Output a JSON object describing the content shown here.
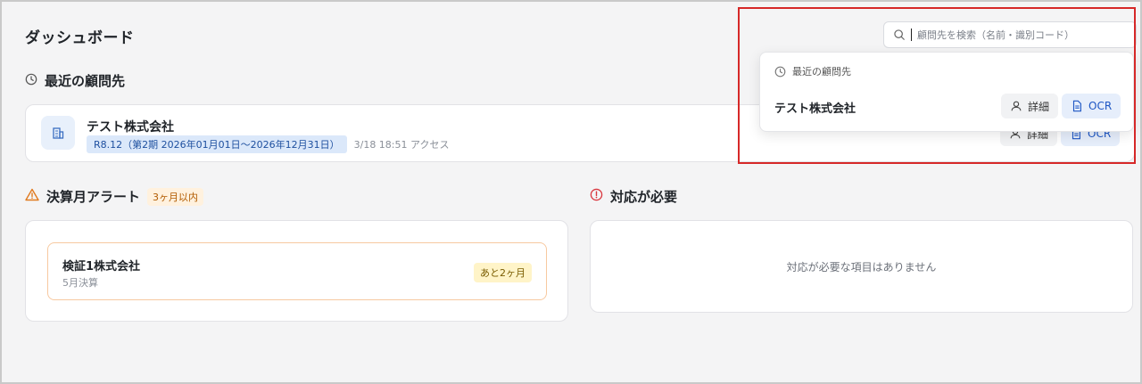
{
  "page": {
    "title": "ダッシュボード"
  },
  "search": {
    "placeholder": "顧問先を検索（名前・識別コード）"
  },
  "recent": {
    "heading": "最近の顧問先",
    "client": {
      "name": "テスト株式会社",
      "period_tag": "R8.12（第2期 2026年01月01日〜2026年12月31日）",
      "access": "3/18 18:51 アクセス"
    },
    "detail_label": "詳細",
    "ocr_label": "OCR"
  },
  "alert": {
    "heading": "決算月アラート",
    "badge": "3ヶ月以内",
    "items": [
      {
        "name": "検証1株式会社",
        "sub": "5月決算",
        "remaining": "あと2ヶ月"
      }
    ]
  },
  "action": {
    "heading": "対応が必要",
    "empty_text": "対応が必要な項目はありません"
  },
  "dropdown": {
    "heading": "最近の顧問先",
    "client_name": "テスト株式会社",
    "detail_label": "詳細",
    "ocr_label": "OCR"
  },
  "colors": {
    "highlight": "#d62828",
    "accent_blue": "#1d56c4",
    "alert_orange": "#e07a1f",
    "required_red": "#d9363e"
  }
}
